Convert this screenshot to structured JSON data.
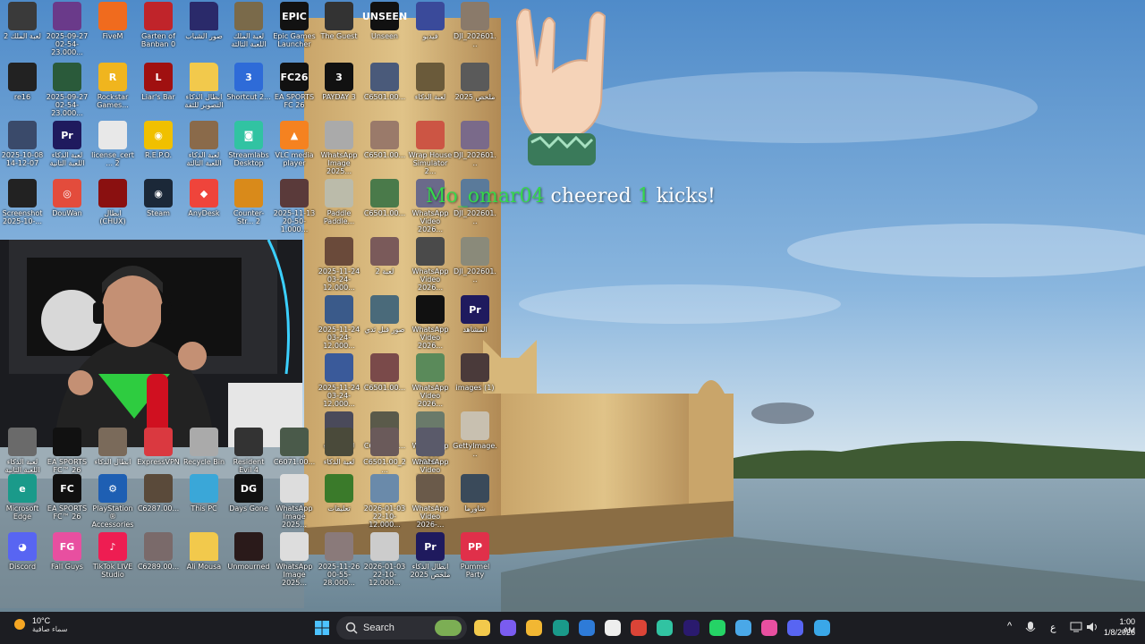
{
  "desktop_icons": [
    {
      "id": "i1",
      "label": "لعبة الملك 2",
      "icon": "video-thumbnail-icon",
      "color": "#3a3a3a"
    },
    {
      "id": "i2",
      "label": "2025-09-27 02-54-23.000...",
      "icon": "video-thumbnail-icon",
      "color": "#6a3a8a"
    },
    {
      "id": "i3",
      "label": "FiveM",
      "icon": "fivem-icon",
      "color": "#f06b1e"
    },
    {
      "id": "i4",
      "label": "Garten of Banban 0",
      "icon": "game-icon",
      "color": "#c0242a"
    },
    {
      "id": "i5",
      "label": "صور الشباب",
      "icon": "folder-icon",
      "color": "#2a2a6a"
    },
    {
      "id": "i6",
      "label": "لعبة الملك اللعبة الثالثة",
      "icon": "video-thumbnail-icon",
      "color": "#7a6a4a"
    },
    {
      "id": "i7",
      "label": "Epic Games Launcher",
      "icon": "epic-games-icon",
      "color": "#121212",
      "text": "EPIC"
    },
    {
      "id": "i8",
      "label": "The Guest",
      "icon": "game-icon",
      "color": "#333"
    },
    {
      "id": "i9",
      "label": "Unseen",
      "icon": "unseen-icon",
      "color": "#111",
      "text": "UNSEEN"
    },
    {
      "id": "i10",
      "label": "فيديو",
      "icon": "video-thumbnail-icon",
      "color": "#3a4a9a"
    },
    {
      "id": "i11",
      "label": "DJI_202601...",
      "icon": "video-thumbnail-icon",
      "color": "#8a7a6a"
    },
    {
      "id": "i12",
      "label": "re16",
      "icon": "video-thumbnail-icon",
      "color": "#222"
    },
    {
      "id": "i13",
      "label": "2025-09-27 02-54-23.000...",
      "icon": "video-thumbnail-icon",
      "color": "#2a5a3a"
    },
    {
      "id": "i14",
      "label": "Rockstar Games...",
      "icon": "rockstar-icon",
      "color": "#f0b51e",
      "text": "R"
    },
    {
      "id": "i15",
      "label": "Liar's Bar",
      "icon": "game-icon",
      "color": "#a01010",
      "text": "L"
    },
    {
      "id": "i16",
      "label": "ابطال الذكاء التصوير للثقة",
      "icon": "folder-icon",
      "color": "#f2c94c"
    },
    {
      "id": "i17",
      "label": "Shortcut 2...",
      "icon": "shortcut-icon",
      "color": "#2e6bd8",
      "text": "3"
    },
    {
      "id": "i18",
      "label": "EA SPORTS FC 26",
      "icon": "ea-fc-icon",
      "color": "#111",
      "text": "FC26"
    },
    {
      "id": "i19",
      "label": "PAYDAY 3",
      "icon": "payday-icon",
      "color": "#111",
      "text": "3"
    },
    {
      "id": "i20",
      "label": "C6501.00...",
      "icon": "video-thumbnail-icon",
      "color": "#4a5a7a"
    },
    {
      "id": "i21",
      "label": "لعبة الذكاء",
      "icon": "video-thumbnail-icon",
      "color": "#6a5a3a"
    },
    {
      "id": "i22",
      "label": "ملخص 2025",
      "icon": "video-thumbnail-icon",
      "color": "#5a5a5a"
    },
    {
      "id": "i23",
      "label": "2025-10-08 14-12-07",
      "icon": "video-thumbnail-icon",
      "color": "#3a4a6a"
    },
    {
      "id": "i24",
      "label": "لعبة الذكاء اللعبة الثانية",
      "icon": "premiere-project-icon",
      "color": "#1f1a5e",
      "text": "Pr"
    },
    {
      "id": "i25",
      "label": "license_cert... 2",
      "icon": "document-icon",
      "color": "#e8e8e8"
    },
    {
      "id": "i26",
      "label": "R.E.P.O.",
      "icon": "repo-icon",
      "color": "#f0c000",
      "text": "◉"
    },
    {
      "id": "i27",
      "label": "لعبة الذكاء اللعبة الثالثة",
      "icon": "video-thumbnail-icon",
      "color": "#8a6a4a"
    },
    {
      "id": "i28",
      "label": "Streamlabs Desktop",
      "icon": "streamlabs-icon",
      "color": "#31c3a2",
      "text": "◙"
    },
    {
      "id": "i29",
      "label": "VLC media player",
      "icon": "vlc-icon",
      "color": "#f58220",
      "text": "▲"
    },
    {
      "id": "i30",
      "label": "WhatsApp Image 2025...",
      "icon": "image-thumbnail-icon",
      "color": "#aaa"
    },
    {
      "id": "i31",
      "label": "C6501.00...",
      "icon": "video-thumbnail-icon",
      "color": "#9a7a6a"
    },
    {
      "id": "i32",
      "label": "Wrap House Simulator 2...",
      "icon": "game-icon",
      "color": "#cc5544"
    },
    {
      "id": "i33",
      "label": "DJI_202601...",
      "icon": "video-thumbnail-icon",
      "color": "#7a6a8a"
    },
    {
      "id": "i34",
      "label": "Screenshot 2025-10-...",
      "icon": "image-thumbnail-icon",
      "color": "#222"
    },
    {
      "id": "i35",
      "label": "DouWan",
      "icon": "douwan-icon",
      "color": "#e34c3c",
      "text": "◎"
    },
    {
      "id": "i36",
      "label": "ابطال (CHUX)",
      "icon": "game-icon",
      "color": "#8a1010"
    },
    {
      "id": "i37",
      "label": "Steam",
      "icon": "steam-icon",
      "color": "#1b2838",
      "text": "◉"
    },
    {
      "id": "i38",
      "label": "AnyDesk",
      "icon": "anydesk-icon",
      "color": "#ef443b",
      "text": "◆"
    },
    {
      "id": "i39",
      "label": "Counter-Str... 2",
      "icon": "counter-strike-icon",
      "color": "#d98a1a"
    },
    {
      "id": "i40",
      "label": "2025-11-13 20-50-1.000...",
      "icon": "video-thumbnail-icon",
      "color": "#5a3a3a"
    },
    {
      "id": "i41",
      "label": "Paddle Paddle...",
      "icon": "game-icon",
      "color": "#bba"
    },
    {
      "id": "i42",
      "label": "C6501.00...",
      "icon": "video-thumbnail-icon",
      "color": "#4a7a4a"
    },
    {
      "id": "i43",
      "label": "WhatsApp Video 2026...",
      "icon": "video-thumbnail-icon",
      "color": "#6a6a8a"
    },
    {
      "id": "i44",
      "label": "DJI_202601...",
      "icon": "video-thumbnail-icon",
      "color": "#5a7a9a"
    },
    {
      "id": "i45",
      "label": "2025-11-24 03-24-12.000...",
      "icon": "video-thumbnail-icon",
      "color": "#6a4a3a"
    },
    {
      "id": "i46",
      "label": "لعبة 2",
      "icon": "video-thumbnail-icon",
      "color": "#7a5a5a"
    },
    {
      "id": "i47",
      "label": "WhatsApp Video 2026...",
      "icon": "video-thumbnail-icon",
      "color": "#4a4a4a"
    },
    {
      "id": "i48",
      "label": "DJI_202601...",
      "icon": "video-thumbnail-icon",
      "color": "#8a8a7a"
    },
    {
      "id": "i49",
      "label": "2025-11-24 03-24-12.000...",
      "icon": "video-thumbnail-icon",
      "color": "#3a5a8a"
    },
    {
      "id": "i50",
      "label": "صور قبل ثدي",
      "icon": "video-thumbnail-icon",
      "color": "#4a6a7a"
    },
    {
      "id": "i51",
      "label": "WhatsApp Video 2026...",
      "icon": "video-thumbnail-icon",
      "color": "#111"
    },
    {
      "id": "i52",
      "label": "المشاهد",
      "icon": "premiere-project-icon",
      "color": "#1f1a5e",
      "text": "Pr"
    },
    {
      "id": "i53",
      "label": "2025-11-24 03-24-12.000...",
      "icon": "video-thumbnail-icon",
      "color": "#3a5a9a"
    },
    {
      "id": "i54",
      "label": "C6501.00...",
      "icon": "video-thumbnail-icon",
      "color": "#7a4a4a"
    },
    {
      "id": "i55",
      "label": "WhatsApp Video 2026...",
      "icon": "video-thumbnail-icon",
      "color": "#5a8a5a"
    },
    {
      "id": "i56",
      "label": "images (1)",
      "icon": "image-thumbnail-icon",
      "color": "#4a3a3a"
    },
    {
      "id": "i57",
      "label": "لعبة الذكاء",
      "icon": "video-thumbnail-icon",
      "color": "#4a4a5a"
    },
    {
      "id": "i58",
      "label": "C6501.00...",
      "icon": "video-thumbnail-icon",
      "color": "#5a5a4a"
    },
    {
      "id": "i59",
      "label": "WhatsApp Video 2026...",
      "icon": "video-thumbnail-icon",
      "color": "#6a7a6a"
    },
    {
      "id": "i60",
      "label": "GettyImage...",
      "icon": "image-thumbnail-icon",
      "color": "#c8c0b0"
    },
    {
      "id": "i61",
      "label": "لعبة الذكاء اللعبة الثانية",
      "icon": "video-thumbnail-icon",
      "color": "#6a6a6a"
    },
    {
      "id": "i62",
      "label": "EA SPORTS FC™ 26",
      "icon": "ea-fc-icon",
      "color": "#111"
    },
    {
      "id": "i63",
      "label": "ابطال الذكاء",
      "icon": "video-thumbnail-icon",
      "color": "#7a6a5a"
    },
    {
      "id": "i64",
      "label": "ExpressVPN",
      "icon": "expressvpn-icon",
      "color": "#da3940"
    },
    {
      "id": "i65",
      "label": "Recycle Bin",
      "icon": "recycle-bin-icon",
      "color": "#aaa"
    },
    {
      "id": "i66",
      "label": "Resident Evil 4",
      "icon": "game-icon",
      "color": "#333"
    },
    {
      "id": "i67",
      "label": "C6071.00...",
      "icon": "video-thumbnail-icon",
      "color": "#4a5a4a"
    },
    {
      "id": "i68",
      "label": "لعبة الذكاء",
      "icon": "video-thumbnail-icon",
      "color": "#4a4a3a"
    },
    {
      "id": "i69",
      "label": "C6501.00_2...",
      "icon": "video-thumbnail-icon",
      "color": "#6a5a5a"
    },
    {
      "id": "i70",
      "label": "WhatsApp Video 2026-...",
      "icon": "video-thumbnail-icon",
      "color": "#5a5a6a"
    },
    {
      "id": "i71",
      "label": "Microsoft Edge",
      "icon": "edge-icon",
      "color": "#1a9a8a",
      "text": "e"
    },
    {
      "id": "i72",
      "label": "EA SPORTS FC™ 26",
      "icon": "ea-fc-icon",
      "color": "#111",
      "text": "FC"
    },
    {
      "id": "i73",
      "label": "PlayStation® Accessories",
      "icon": "playstation-icon",
      "color": "#1e5fb3",
      "text": "⚙"
    },
    {
      "id": "i74",
      "label": "C6287.00...",
      "icon": "video-thumbnail-icon",
      "color": "#5a4a3a"
    },
    {
      "id": "i75",
      "label": "This PC",
      "icon": "this-pc-icon",
      "color": "#3aa7d8"
    },
    {
      "id": "i76",
      "label": "Days Gone",
      "icon": "game-icon",
      "color": "#111",
      "text": "DG"
    },
    {
      "id": "i77",
      "label": "WhatsApp Image 2025...",
      "icon": "image-thumbnail-icon",
      "color": "#ddd"
    },
    {
      "id": "i78",
      "label": "تعليقات",
      "icon": "video-thumbnail-icon",
      "color": "#3a7a2a"
    },
    {
      "id": "i79",
      "label": "2026-01-03 22-10-12.000...",
      "icon": "video-thumbnail-icon",
      "color": "#6a8aaa"
    },
    {
      "id": "i80",
      "label": "WhatsApp Video 2026-...",
      "icon": "video-thumbnail-icon",
      "color": "#6a5a4a"
    },
    {
      "id": "i81",
      "label": "شاورما",
      "icon": "video-thumbnail-icon",
      "color": "#3a4a5a"
    },
    {
      "id": "i82",
      "label": "Discord",
      "icon": "discord-icon",
      "color": "#5865f2",
      "text": "◕"
    },
    {
      "id": "i83",
      "label": "Fall Guys",
      "icon": "fall-guys-icon",
      "color": "#e84fa0",
      "text": "FG"
    },
    {
      "id": "i84",
      "label": "TikTok LIVE Studio",
      "icon": "tiktok-icon",
      "color": "#ee1d52",
      "text": "♪"
    },
    {
      "id": "i85",
      "label": "C6289.00...",
      "icon": "video-thumbnail-icon",
      "color": "#7a6a6a"
    },
    {
      "id": "i86",
      "label": "Ali Mousa",
      "icon": "folder-icon",
      "color": "#f2c94c"
    },
    {
      "id": "i87",
      "label": "Unmourned",
      "icon": "game-icon",
      "color": "#2a1a1a"
    },
    {
      "id": "i88",
      "label": "WhatsApp Image 2025...",
      "icon": "image-thumbnail-icon",
      "color": "#ddd"
    },
    {
      "id": "i89",
      "label": "2025-11-26 00-55-28.000...",
      "icon": "video-thumbnail-icon",
      "color": "#8a7a7a"
    },
    {
      "id": "i90",
      "label": "2026-01-03 22-10-12.000...",
      "icon": "video-thumbnail-icon",
      "color": "#ccc"
    },
    {
      "id": "i91",
      "label": "ابطال الذكاء ملخص 2025",
      "icon": "premiere-project-icon",
      "color": "#1f1a5e",
      "text": "Pr"
    },
    {
      "id": "i92",
      "label": "Pummel Party",
      "icon": "pummel-party-icon",
      "color": "#e0304a",
      "text": "PP"
    }
  ],
  "overlay": {
    "cheer_user": "Mo_omar04",
    "cheer_text": "cheered",
    "cheer_amount": "1",
    "cheer_suffix": "kicks!"
  },
  "taskbar": {
    "weather": {
      "temp": "10°C",
      "condition": "سماء صافية",
      "icon": "weather-sun-icon"
    },
    "search_placeholder": "Search",
    "pinned": [
      {
        "name": "file-explorer-icon",
        "color": "#f2c94c"
      },
      {
        "name": "copilot-icon",
        "color": "#7a5cf0"
      },
      {
        "name": "folder-icon",
        "color": "#f2b733"
      },
      {
        "name": "edge-icon",
        "color": "#1a9a8a"
      },
      {
        "name": "store-icon",
        "color": "#2e7bd8"
      },
      {
        "name": "ghost-icon",
        "color": "#eee"
      },
      {
        "name": "chrome-icon",
        "color": "#db4437"
      },
      {
        "name": "streamlabs-icon",
        "color": "#31c3a2"
      },
      {
        "name": "premiere-icon",
        "color": "#2a1a6e"
      },
      {
        "name": "whatsapp-icon",
        "color": "#25d366"
      },
      {
        "name": "app-icon",
        "color": "#4aa8e8"
      },
      {
        "name": "itunes-icon",
        "color": "#e84fa0"
      },
      {
        "name": "discord-icon",
        "color": "#5865f2"
      },
      {
        "name": "chat-icon",
        "color": "#3aa7e8"
      }
    ],
    "lang": "ع",
    "time": "1:00 AM",
    "date": "1/8/2026"
  }
}
